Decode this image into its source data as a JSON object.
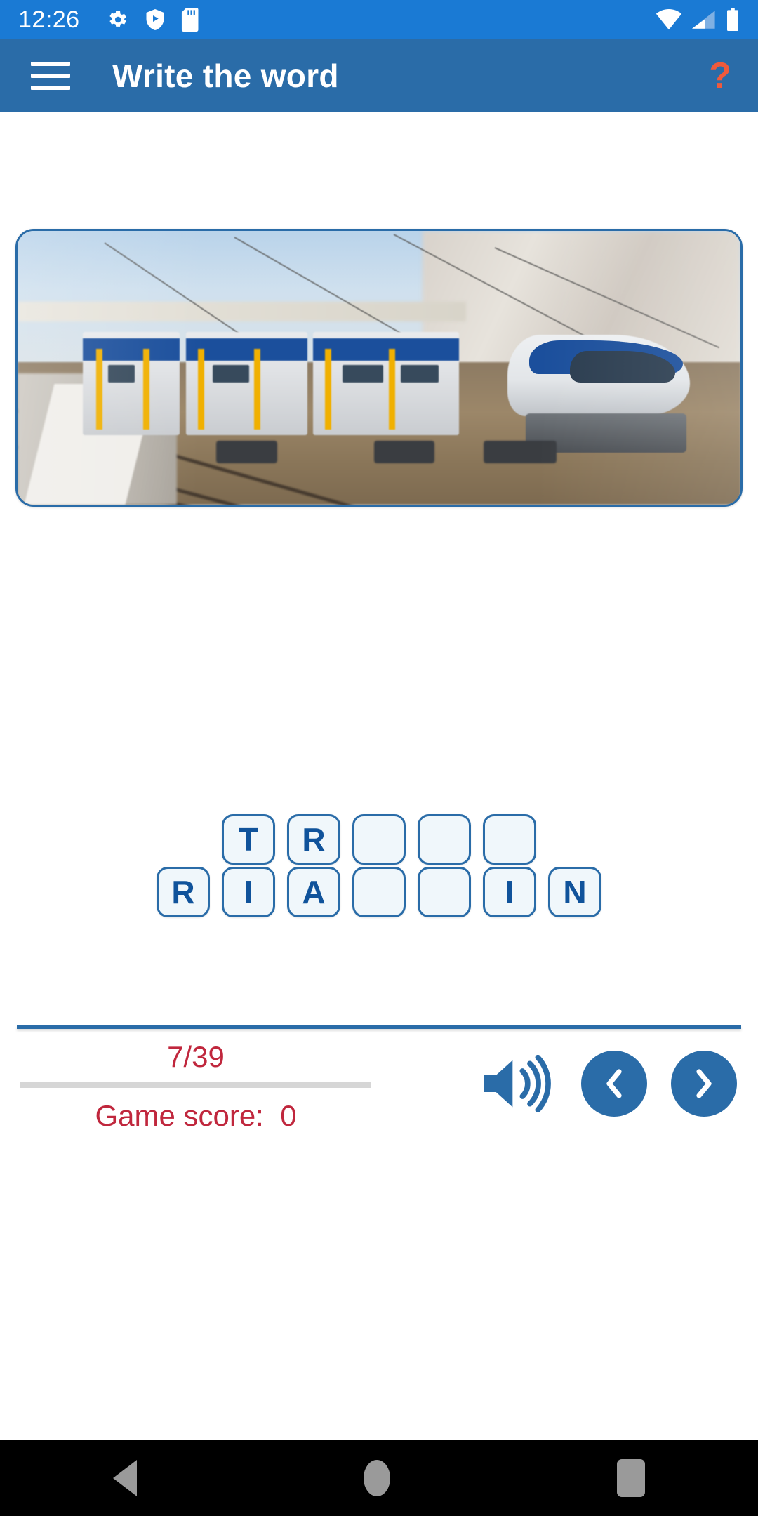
{
  "status_bar": {
    "time": "12:26",
    "left_icons": [
      "gear-icon",
      "play-protect-shield-icon",
      "sd-card-icon"
    ],
    "right_icons": [
      "wifi-icon",
      "cellular-signal-icon",
      "battery-icon"
    ],
    "background_color": "#1a7ad4"
  },
  "app_bar": {
    "menu_icon": "hamburger-menu-icon",
    "title": "Write the word",
    "help_label": "?",
    "help_color": "#ef5a3c",
    "background_color": "#2a6ca8"
  },
  "picture": {
    "alt": "blurred photo of a blue and white passenger train speeding along railway tracks past a station platform",
    "border_color": "#2a6ca8"
  },
  "answer_row": {
    "name": "answer-slots",
    "tiles": [
      "T",
      "R",
      "",
      "",
      ""
    ]
  },
  "letter_bank": {
    "name": "letter-bank",
    "tiles": [
      "R",
      "I",
      "A",
      "",
      "",
      "I",
      "N"
    ]
  },
  "footer": {
    "progress_text": "7/39",
    "progress_current": 7,
    "progress_total": 39,
    "game_score_label": "Game score:  0",
    "text_color": "#c0273d",
    "speaker_icon": "speaker-volume-icon",
    "previous_icon": "chevron-left-icon",
    "next_icon": "chevron-right-icon",
    "button_color": "#2a6ca8"
  },
  "android_nav": {
    "back": "back-triangle-icon",
    "home": "home-circle-icon",
    "recents": "recents-square-icon"
  }
}
